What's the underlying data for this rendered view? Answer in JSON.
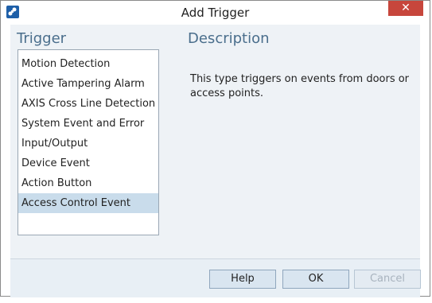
{
  "window": {
    "title": "Add Trigger",
    "close_label": "✕"
  },
  "trigger": {
    "heading": "Trigger",
    "items": [
      {
        "label": "Motion Detection",
        "selected": false
      },
      {
        "label": "Active Tampering Alarm",
        "selected": false
      },
      {
        "label": "AXIS Cross Line Detection",
        "selected": false
      },
      {
        "label": "System Event and Error",
        "selected": false
      },
      {
        "label": "Input/Output",
        "selected": false
      },
      {
        "label": "Device Event",
        "selected": false
      },
      {
        "label": "Action Button",
        "selected": false
      },
      {
        "label": "Access Control Event",
        "selected": true
      }
    ]
  },
  "description": {
    "heading": "Description",
    "text": "This type triggers on events from doors or access points."
  },
  "buttons": {
    "help": "Help",
    "ok": "OK",
    "cancel": "Cancel"
  },
  "icons": {
    "app": "app-icon",
    "close": "close-icon"
  },
  "colors": {
    "heading": "#4a6e8c",
    "selected_row": "#c9dceb",
    "close_button": "#c7463c"
  }
}
